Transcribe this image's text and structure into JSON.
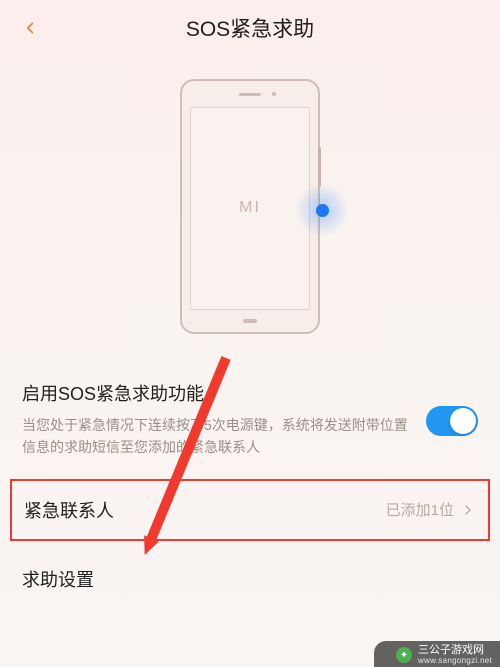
{
  "header": {
    "title": "SOS紧急求助"
  },
  "illustration": {
    "logo": "MI"
  },
  "enable": {
    "title": "启用SOS紧急求助功能",
    "description": "当您处于紧急情况下连续按下5次电源键，系统将发送附带位置信息的求助短信至您添加的紧急联系人",
    "toggle_on": true
  },
  "rows": {
    "contacts": {
      "label": "紧急联系人",
      "value": "已添加1位"
    },
    "settings": {
      "label": "求助设置"
    }
  },
  "watermark": {
    "name": "三公子游戏网",
    "url": "www.sangongzi.net"
  }
}
